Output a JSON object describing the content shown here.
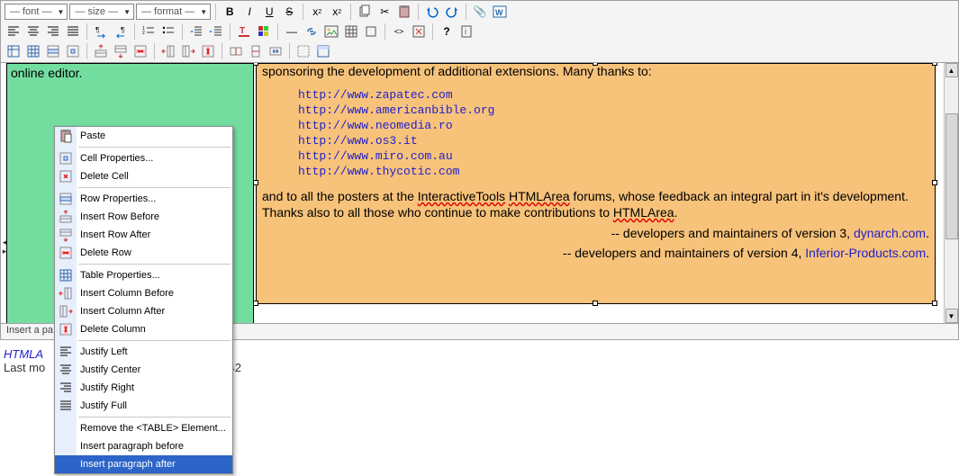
{
  "toolbar": {
    "font_combo": "— font —",
    "size_combo": "— size —",
    "format_combo": "— format —"
  },
  "editor": {
    "left_cell_text": "online editor.",
    "right_top": "sponsoring the development of additional extensions. Many thanks to:",
    "links": [
      "http://www.zapatec.com",
      "http://www.americanbible.org",
      "http://www.neomedia.ro",
      "http://www.os3.it",
      "http://www.miro.com.au",
      "http://www.thycotic.com"
    ],
    "para2_a": "and to all the posters at the ",
    "para2_wavy1": "InteractiveTools",
    "para2_b": " ",
    "para2_wavy2": "HTMLArea",
    "para2_c": " forums, whose feedback an integral part in it's development. Thanks also to all those who continue to make contributions to ",
    "para2_wavy3": "HTMLArea",
    "para2_d": ".",
    "credit3_text": "-- developers and maintainers of version 3, ",
    "credit3_link": "dynarch.com",
    "credit4_text": "-- developers and maintainers of version 4, ",
    "credit4_link": "Inferior-Products.com"
  },
  "statusbar": {
    "text": "Insert a pa"
  },
  "footer": {
    "line1": "HTMLA",
    "line2_a": "Last mo",
    "line2_b": "42"
  },
  "context_menu": {
    "items": [
      {
        "label": "Paste",
        "icon": "paste-icon"
      },
      {
        "sep": true
      },
      {
        "label": "Cell Properties...",
        "icon": "cell-props-icon"
      },
      {
        "label": "Delete Cell",
        "icon": "delete-cell-icon"
      },
      {
        "sep": true
      },
      {
        "label": "Row Properties...",
        "icon": "row-props-icon"
      },
      {
        "label": "Insert Row Before",
        "icon": "insert-row-before-icon"
      },
      {
        "label": "Insert Row After",
        "icon": "insert-row-after-icon"
      },
      {
        "label": "Delete Row",
        "icon": "delete-row-icon"
      },
      {
        "sep": true
      },
      {
        "label": "Table Properties...",
        "icon": "table-props-icon"
      },
      {
        "label": "Insert Column Before",
        "icon": "insert-col-before-icon"
      },
      {
        "label": "Insert Column After",
        "icon": "insert-col-after-icon"
      },
      {
        "label": "Delete Column",
        "icon": "delete-col-icon"
      },
      {
        "sep": true
      },
      {
        "label": "Justify Left",
        "icon": "justify-left-icon"
      },
      {
        "label": "Justify Center",
        "icon": "justify-center-icon"
      },
      {
        "label": "Justify Right",
        "icon": "justify-right-icon"
      },
      {
        "label": "Justify Full",
        "icon": "justify-full-icon"
      },
      {
        "sep": true
      },
      {
        "label": "Remove the <TABLE> Element...",
        "icon": ""
      },
      {
        "label": "Insert paragraph before",
        "icon": ""
      },
      {
        "label": "Insert paragraph after",
        "icon": "",
        "highlight": true
      }
    ]
  }
}
